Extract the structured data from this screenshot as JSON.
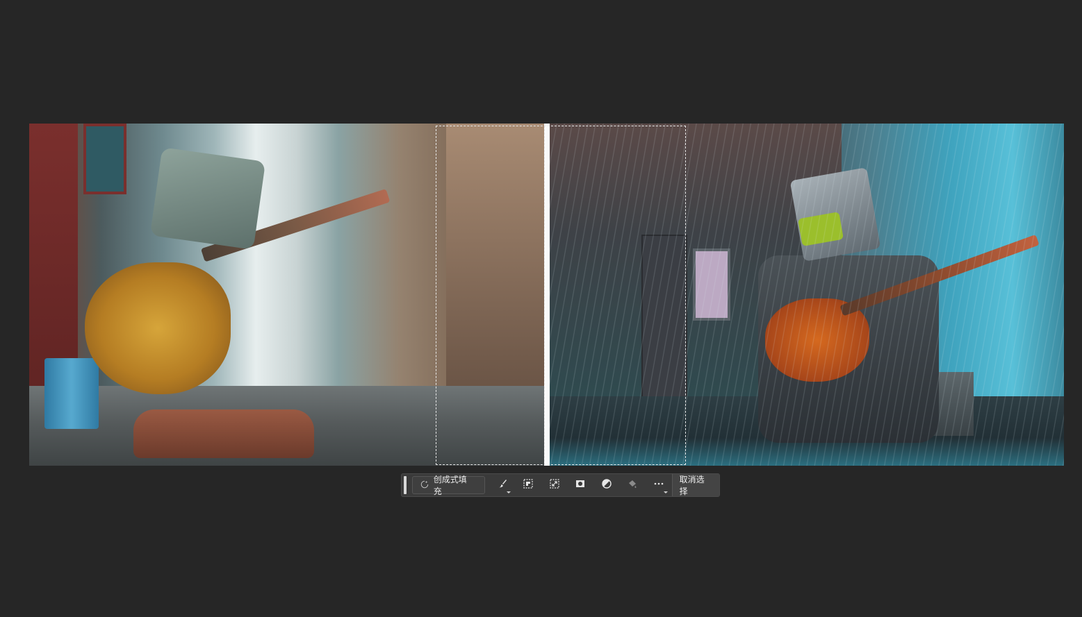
{
  "canvas": {
    "left_image": "robot-playing-guitar-street-photo",
    "right_image": "robot-playing-guitar-rain-illustration"
  },
  "taskbar": {
    "generative_fill_label": "创成式填充",
    "deselect_label": "取消选择",
    "tools": [
      {
        "name": "brush-icon",
        "has_menu": true
      },
      {
        "name": "select-subject-icon",
        "has_menu": false
      },
      {
        "name": "transform-icon",
        "has_menu": false
      },
      {
        "name": "mask-icon",
        "has_menu": false
      },
      {
        "name": "adjustment-icon",
        "has_menu": false
      },
      {
        "name": "fill-bucket-icon",
        "has_menu": false
      },
      {
        "name": "more-options-icon",
        "has_menu": true
      }
    ]
  },
  "colors": {
    "workspace": "#262626",
    "taskbar": "#3a3a3a",
    "selection": "#e8e8e8"
  }
}
